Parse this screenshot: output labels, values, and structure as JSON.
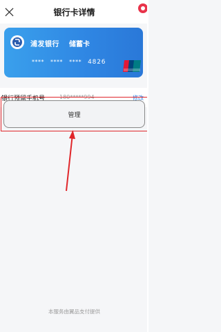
{
  "header": {
    "title": "银行卡详情",
    "close_icon": "close-icon",
    "status_icon": "app-badge-icon"
  },
  "card": {
    "bank_name": "浦发银行",
    "card_type": "储蓄卡",
    "masked_groups": "**** **** ****",
    "last4": "4826",
    "network_logo": "unionpay-logo",
    "colors": {
      "gradient_start": "#3aa0ec",
      "gradient_end": "#2a78d8"
    }
  },
  "phone": {
    "label": "银行预留手机号",
    "value": "180*****994",
    "modify_label": "修改",
    "link_color": "#2f7fe5"
  },
  "manage": {
    "label": "管理"
  },
  "annotation": {
    "highlight_color": "#e0262a"
  },
  "footer": {
    "text": "本服务由翼品支付提供"
  }
}
